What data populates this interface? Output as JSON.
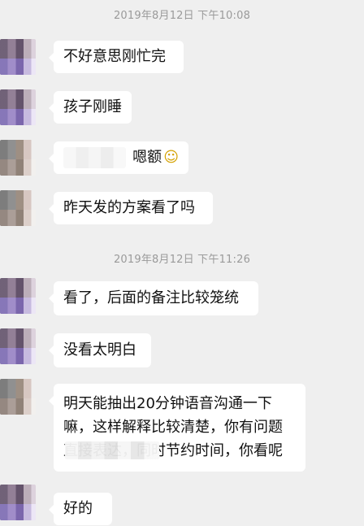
{
  "chat": {
    "timestamps": [
      "2019年8月12日 下午10:08",
      "2019年8月12日 下午11:26"
    ],
    "messages": [
      {
        "text": "不好意思刚忙完"
      },
      {
        "text": "孩子刚睡"
      },
      {
        "text": "嗯额",
        "emoji": "☺"
      },
      {
        "text": "昨天发的方案看了吗"
      },
      {
        "text": "看了，后面的备注比较笼统"
      },
      {
        "text": "没看太明白"
      },
      {
        "text": "明天能抽出20分钟语音沟通一下嘛，这样解释比较清楚，你有问题直接表达，同时节约时间，你看呢"
      },
      {
        "text": "好的"
      }
    ]
  }
}
